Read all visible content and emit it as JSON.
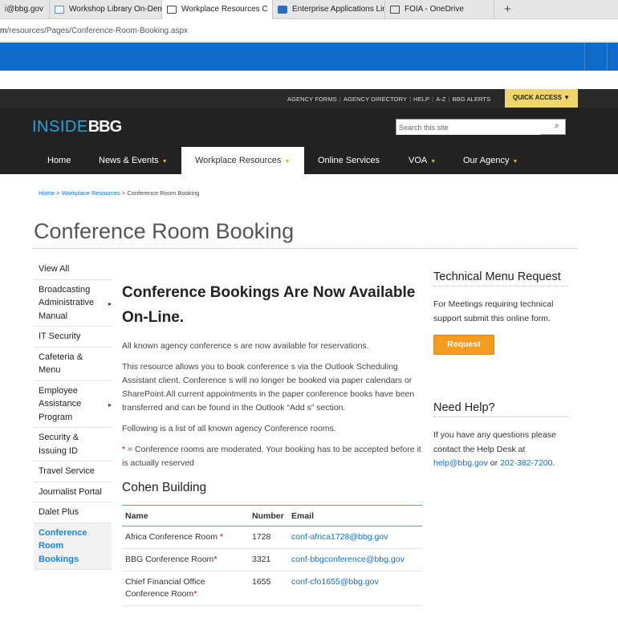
{
  "browser": {
    "tabs": [
      {
        "label": "i@bbg.gov",
        "icon": "none"
      },
      {
        "label": "Workshop Library On-Demz",
        "icon": "mail-icon"
      },
      {
        "label": "Workplace Resources C",
        "icon": "page-icon",
        "active": true,
        "close": "×"
      },
      {
        "label": "Enterprise Applications Limi",
        "icon": "sharepoint-icon"
      },
      {
        "label": "FOIA - OneDrive",
        "icon": "page-icon"
      }
    ],
    "new_tab": "+",
    "address_prefix": "m",
    "address_path": "/resources/Pages/Conference-Room-Booking.aspx"
  },
  "header": {
    "top_links": [
      "AGENCY FORMS",
      "AGENCY DIRECTORY",
      "HELP",
      "A-Z",
      "BBG ALERTS"
    ],
    "quick_access": "QUICK ACCESS ▼",
    "logo_inside": "INSIDE",
    "logo_bbg": "BBG",
    "search_placeholder": "Search this site",
    "search_icon": "⌕"
  },
  "nav": {
    "home": "Home",
    "news": "News & Events",
    "workplace": "Workplace Resources",
    "online": "Online Services",
    "voa": "VOA",
    "agency": "Our Agency",
    "caret": "▼"
  },
  "breadcrumb": {
    "home": "Home",
    "sep1": " > ",
    "workplace": "Workplace Resources",
    "sep2": " > ",
    "current": "Conference Room Booking"
  },
  "page_title": "Conference Room Booking",
  "leftnav": [
    {
      "label": "View All",
      "arrow": ""
    },
    {
      "label": "Broadcasting Administrative Manual",
      "arrow": "▸"
    },
    {
      "label": "IT Security",
      "arrow": ""
    },
    {
      "label": "Cafeteria & Menu",
      "arrow": ""
    },
    {
      "label": "Employee Assistance Program",
      "arrow": "▸"
    },
    {
      "label": "Security & Issuing ID",
      "arrow": ""
    },
    {
      "label": "Travel Service",
      "arrow": ""
    },
    {
      "label": "Journalist Portal",
      "arrow": ""
    },
    {
      "label": "Dalet Plus",
      "arrow": ""
    },
    {
      "label": "Conference Room Bookings",
      "arrow": "",
      "active": true
    }
  ],
  "main": {
    "heading": "Conference Bookings Are Now Available On-Line.",
    "p1": "All known agency conference s are now available for reservations.",
    "p2": "This resource allows you to book conference s via the Outlook Scheduling Assistant client. Conference s will no longer be booked via paper calendars or SharePoint.All current appointments in the paper conference books have been transferred and can be found in the Outlook “Add s” section.",
    "p3": "Following is a list of all known agency Conference rooms.",
    "p4_star": "*",
    "p4_rest": " = Conference rooms are moderated. Your booking has to be accepted before it is actually reserved",
    "building": "Cohen Building",
    "table": {
      "headers": [
        "Name",
        "Number",
        "Email"
      ],
      "rows": [
        {
          "name": "Africa Conference Room",
          "star": " *",
          "number": "1728",
          "email": "conf-africa1728@bbg.gov"
        },
        {
          "name": "BBG Conference Room",
          "star": "*",
          "number": "3321",
          "email": "conf-bbgconference@bbg.gov"
        },
        {
          "name": "Chief Financial Office Conference Room",
          "star": "*",
          "number": "1655",
          "email": "conf-cfo1655@bbg.gov"
        }
      ]
    }
  },
  "right": {
    "tech_title": "Technical Menu Request",
    "tech_text": "For Meetings requiring technical support submit this online form.",
    "request_button": "Request",
    "help_title": "Need Help?",
    "help_text": "If you have any questions please contact the Help Desk at",
    "help_email": "help@bbg.gov",
    "help_or": " or",
    "help_phone": "202-382-7200",
    "help_end": "."
  },
  "colors": {
    "suite_blue": "#0f6ac9",
    "header_dark": "#222222",
    "quick_access_yellow": "#f0d66a",
    "link_blue": "#0a74d1",
    "request_orange": "#f39c1f",
    "logo_blue": "#27a2dc"
  }
}
